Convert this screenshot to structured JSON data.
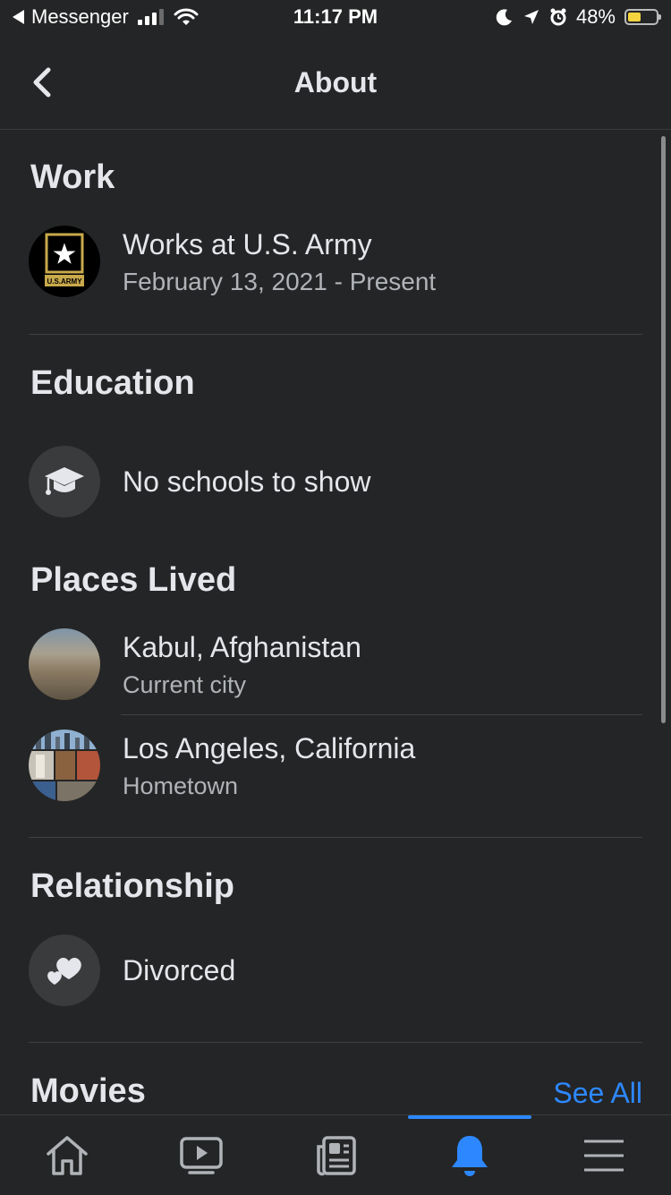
{
  "status_bar": {
    "back_app": "Messenger",
    "time": "11:17 PM",
    "battery": "48%",
    "battery_level": 0.48
  },
  "header": {
    "title": "About"
  },
  "sections": {
    "work": {
      "title": "Work",
      "item": {
        "title": "Works at U.S. Army",
        "subtitle": "February 13, 2021 - Present",
        "logo_text": "U.S.ARMY"
      }
    },
    "education": {
      "title": "Education",
      "item": {
        "title": "No schools to show"
      }
    },
    "places": {
      "title": "Places Lived",
      "items": [
        {
          "title": "Kabul, Afghanistan",
          "subtitle": "Current city"
        },
        {
          "title": "Los Angeles, California",
          "subtitle": "Hometown"
        }
      ]
    },
    "relationship": {
      "title": "Relationship",
      "item": {
        "title": "Divorced"
      }
    },
    "movies": {
      "title": "Movies",
      "see_all": "See All"
    }
  },
  "tabs": [
    {
      "icon": "home-icon",
      "active": false
    },
    {
      "icon": "video-icon",
      "active": false
    },
    {
      "icon": "news-icon",
      "active": false
    },
    {
      "icon": "bell-icon",
      "active": true
    },
    {
      "icon": "menu-icon",
      "active": false
    }
  ],
  "colors": {
    "background": "#242526",
    "accent": "#2d88ff",
    "text": "#e4e6eb",
    "secondary": "#b0b3b8"
  }
}
